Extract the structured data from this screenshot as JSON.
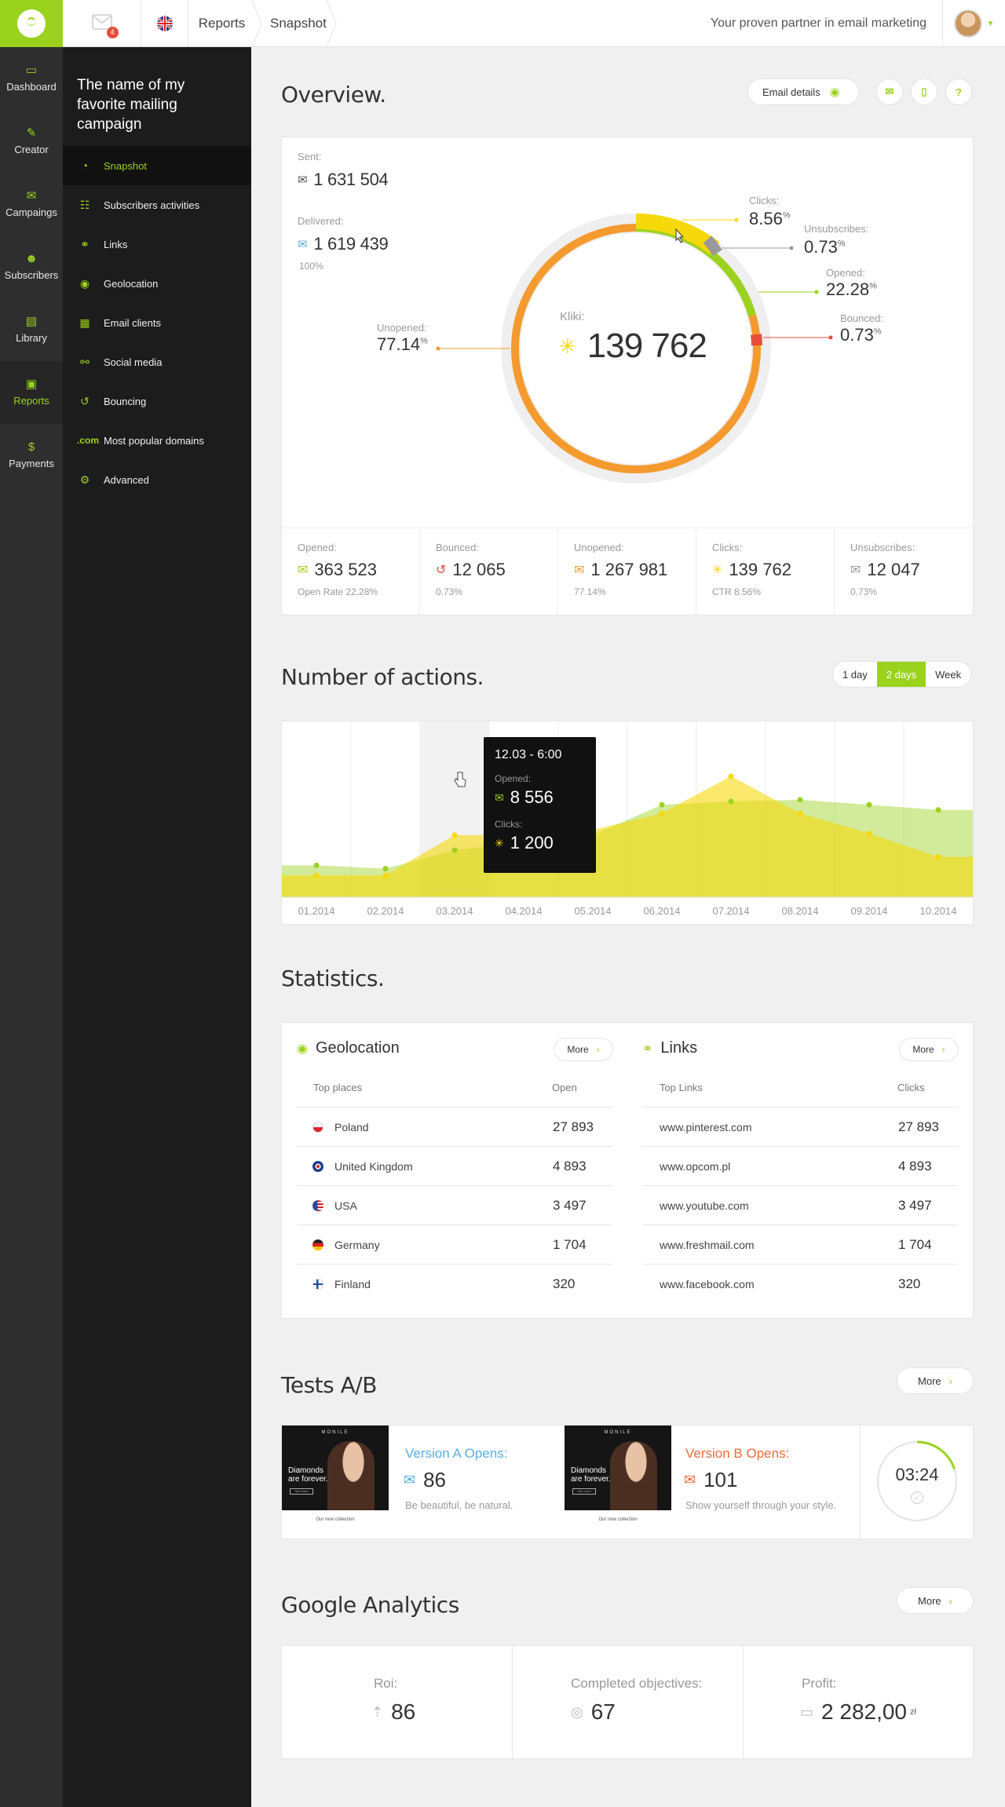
{
  "topbar": {
    "mail_badge": "4",
    "breadcrumbs": [
      "Reports",
      "Snapshot"
    ],
    "tagline": "Your proven partner in email marketing"
  },
  "rail": [
    {
      "label": "Dashboard",
      "icon": "monitor-icon"
    },
    {
      "label": "Creator",
      "icon": "pencil-icon"
    },
    {
      "label": "Campaings",
      "icon": "envelope-icon"
    },
    {
      "label": "Subscribers",
      "icon": "users-icon"
    },
    {
      "label": "Library",
      "icon": "book-icon"
    },
    {
      "label": "Reports",
      "icon": "report-icon",
      "active": true
    },
    {
      "label": "Payments",
      "icon": "dollar-icon"
    }
  ],
  "submenu": {
    "title": "The name of my favorite mailing campaign",
    "items": [
      {
        "label": "Snapshot",
        "icon": "pie-icon",
        "active": true
      },
      {
        "label": "Subscribers activities",
        "icon": "subscriber-icon"
      },
      {
        "label": "Links",
        "icon": "link-icon"
      },
      {
        "label": "Geolocation",
        "icon": "pin-icon"
      },
      {
        "label": "Email clients",
        "icon": "email-client-icon"
      },
      {
        "label": "Social media",
        "icon": "share-icon"
      },
      {
        "label": "Bouncing",
        "icon": "bounce-icon"
      },
      {
        "label": "Most popular domains",
        "icon": "dotcom-icon",
        "prefix": ".com"
      },
      {
        "label": "Advanced",
        "icon": "gear-icon"
      }
    ]
  },
  "overview": {
    "title": "Overview.",
    "email_details": "Email details",
    "sent_label": "Sent:",
    "sent_value": "1 631 504",
    "delivered_label": "Delivered:",
    "delivered_value": "1 619 439",
    "delivered_pct": "100%",
    "center_label": "Kliki:",
    "center_value": "139 762",
    "ring": {
      "clicks_label": "Clicks:",
      "clicks_value": "8.56",
      "clicks_unit": "%",
      "unsub_label": "Unsubscribes:",
      "unsub_value": "0.73",
      "unsub_unit": "%",
      "opened_label": "Opened:",
      "opened_value": "22.28",
      "opened_unit": "%",
      "bounced_label": "Bounced:",
      "bounced_value": "0.73",
      "bounced_unit": "%",
      "unopened_label": "Unopened:",
      "unopened_value": "77.14",
      "unopened_unit": "%"
    },
    "stats": [
      {
        "label": "Opened:",
        "value": "363 523",
        "sub": "Open Rate 22.28%",
        "icon": "open-envelope-icon",
        "color": "#9bd21e"
      },
      {
        "label": "Bounced:",
        "value": "12 065",
        "sub": "0.73%",
        "icon": "bounce-icon",
        "color": "#e74c3c"
      },
      {
        "label": "Unopened:",
        "value": "1 267 981",
        "sub": "77.14%",
        "icon": "envelope-icon",
        "color": "#f39a2e"
      },
      {
        "label": "Clicks:",
        "value": "139 762",
        "sub": "CTR 8.56%",
        "icon": "click-icon",
        "color": "#f5d90a"
      },
      {
        "label": "Unsubscribes:",
        "value": "12 047",
        "sub": "0.73%",
        "icon": "unsub-icon",
        "color": "#999999"
      }
    ]
  },
  "actions": {
    "title": "Number of actions.",
    "ranges": [
      "1 day",
      "2 days",
      "Week"
    ],
    "active_range": "2 days",
    "tooltip": {
      "time": "12.03 - 6:00",
      "opened_label": "Opened:",
      "opened_value": "8 556",
      "clicks_label": "Clicks:",
      "clicks_value": "1 200"
    }
  },
  "chart_data": {
    "type": "area",
    "categories": [
      "01.2014",
      "02.2014",
      "03.2014",
      "04.2014",
      "05.2014",
      "06.2014",
      "07.2014",
      "08.2014",
      "09.2014",
      "10.2014"
    ],
    "series": [
      {
        "name": "Opened",
        "color": "#9bd21e",
        "values": [
          19,
          17,
          28,
          33,
          37,
          55,
          57,
          58,
          55,
          52
        ]
      },
      {
        "name": "Clicks",
        "color": "#f5d90a",
        "values": [
          13,
          13,
          37,
          37,
          40,
          50,
          72,
          50,
          38,
          24
        ]
      }
    ],
    "ylim": [
      0,
      100
    ]
  },
  "statistics": {
    "title": "Statistics.",
    "geo": {
      "title": "Geolocation",
      "more": "More",
      "col1": "Top places",
      "col2": "Open",
      "rows": [
        {
          "name": "Poland",
          "value": "27 893",
          "flag": "pl"
        },
        {
          "name": "United Kingdom",
          "value": "4 893",
          "flag": "uk"
        },
        {
          "name": "USA",
          "value": "3 497",
          "flag": "us"
        },
        {
          "name": "Germany",
          "value": "1 704",
          "flag": "de"
        },
        {
          "name": "Finland",
          "value": "320",
          "flag": "fi"
        }
      ]
    },
    "links": {
      "title": "Links",
      "more": "More",
      "col1": "Top Links",
      "col2": "Clicks",
      "rows": [
        {
          "name": "www.pinterest.com",
          "value": "27 893"
        },
        {
          "name": "www.opcom.pl",
          "value": "4 893"
        },
        {
          "name": "www.youtube.com",
          "value": "3 497"
        },
        {
          "name": "www.freshmail.com",
          "value": "1 704"
        },
        {
          "name": "www.facebook.com",
          "value": "320"
        }
      ]
    }
  },
  "ab": {
    "title": "Tests A/B",
    "more": "More",
    "a_title": "Version A Opens:",
    "a_value": "86",
    "a_sub": "Be beautiful, be natural.",
    "b_title": "Version B Opens:",
    "b_value": "101",
    "b_sub": "Show yourself through your style.",
    "timer": "03:24",
    "timer_progress": 0.2,
    "thumb_brand": "MONILE",
    "thumb_headline": "Diamonds are forever.",
    "thumb_caption": "Our new collection",
    "thumb_button": "See more",
    "a_color": "#5aaee0",
    "b_color": "#ef6a3a"
  },
  "ga": {
    "title": "Google Analytics",
    "more": "More",
    "roi_label": "Roi:",
    "roi_value": "86",
    "obj_label": "Completed objectives:",
    "obj_value": "67",
    "profit_label": "Profit:",
    "profit_value": "2 282,00",
    "profit_unit": "zł"
  }
}
